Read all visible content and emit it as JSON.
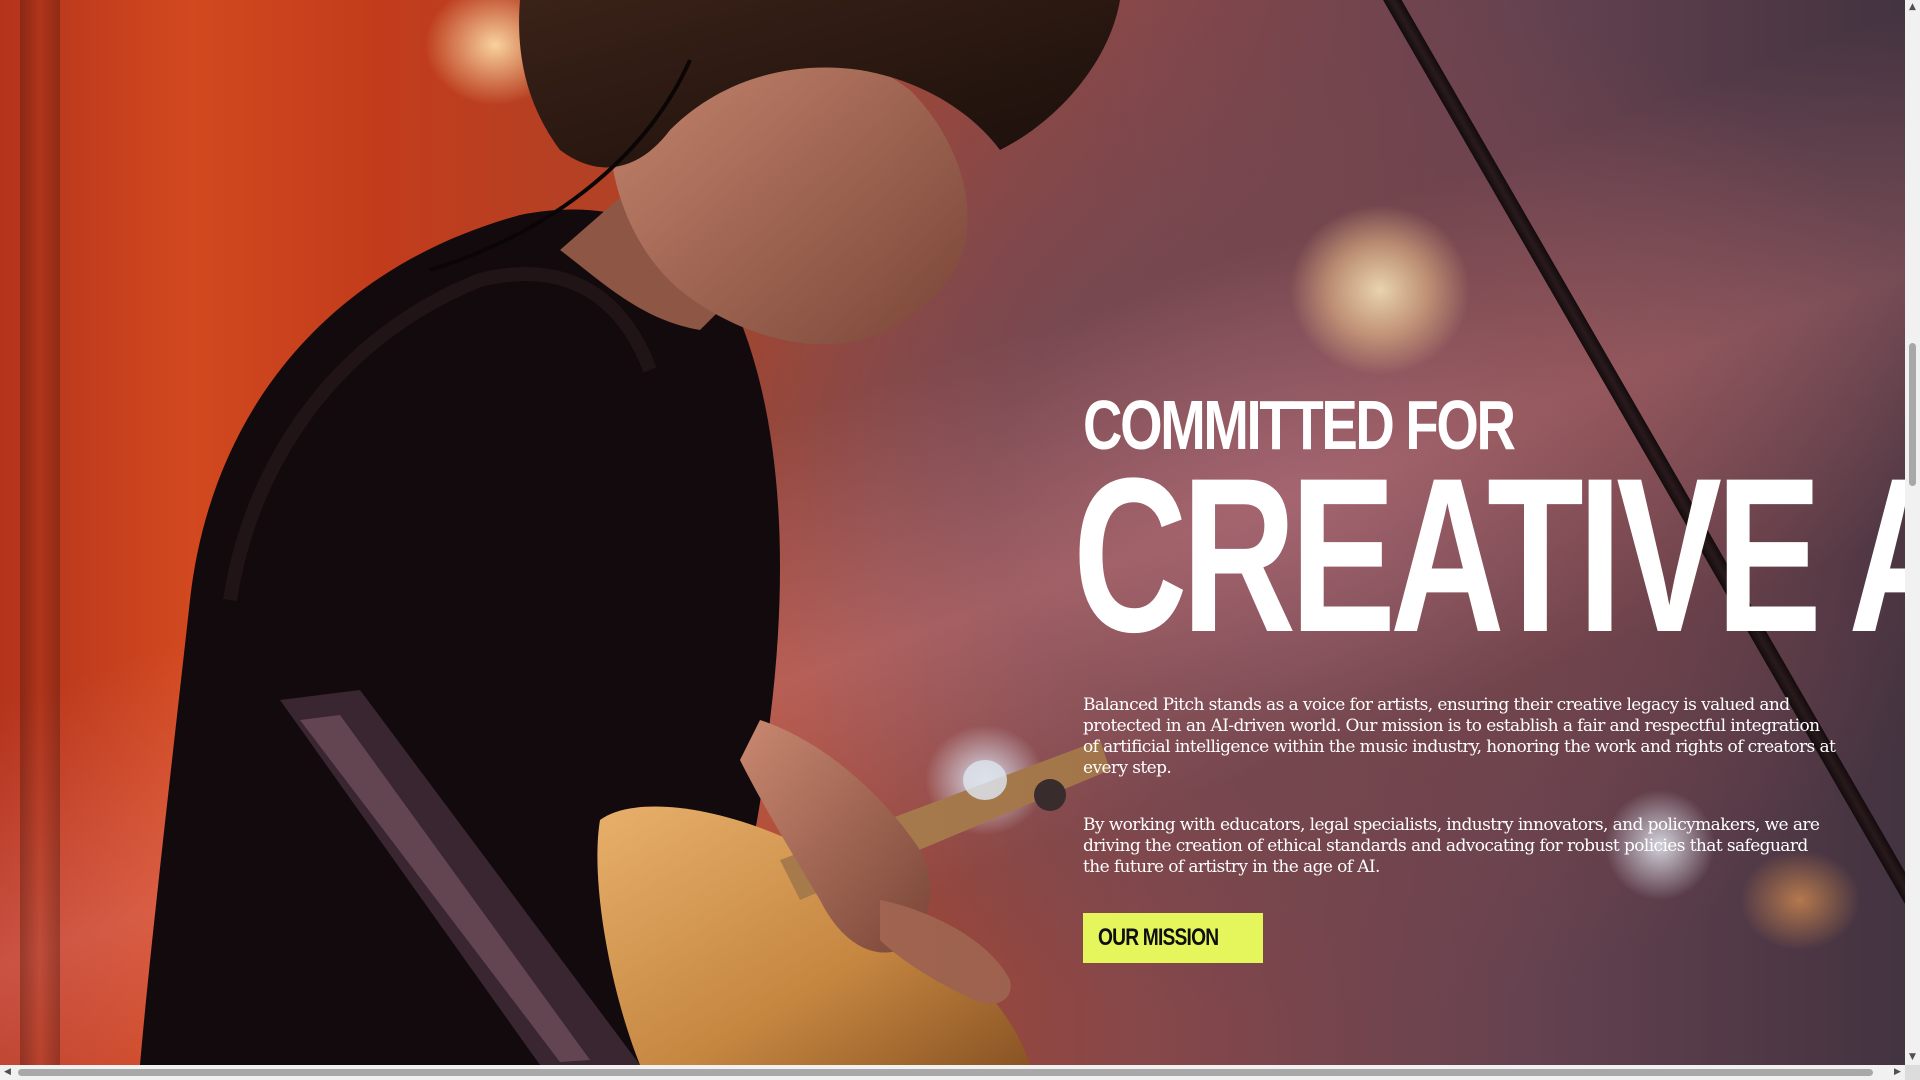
{
  "hero": {
    "background_image": "musician-playing-bass-guitar-on-stage",
    "eyebrow": "COMMITTED FOR",
    "headline": "CREATIVE AI",
    "paragraphs": [
      "Balanced Pitch stands as a voice for artists, ensuring their creative legacy is valued and protected in an AI-driven world. Our mission is to establish a fair and respectful integration of artificial intelligence within the music industry, honoring the work and rights of creators at every step.",
      "By working with educators, legal specialists, industry innovators, and policymakers, we are driving the creation of ethical standards and advocating for robust policies that safeguard the future of artistry in the age of AI."
    ],
    "cta_label": "OUR MISSION"
  },
  "colors": {
    "cta_background": "#e4f65c",
    "headline_text": "#ffffff",
    "body_text": "#ffffff"
  },
  "scrollbars": {
    "vertical": {
      "up_icon": "▲",
      "down_icon": "▼"
    },
    "horizontal": {
      "left_icon": "◀",
      "right_icon": "▶"
    }
  }
}
